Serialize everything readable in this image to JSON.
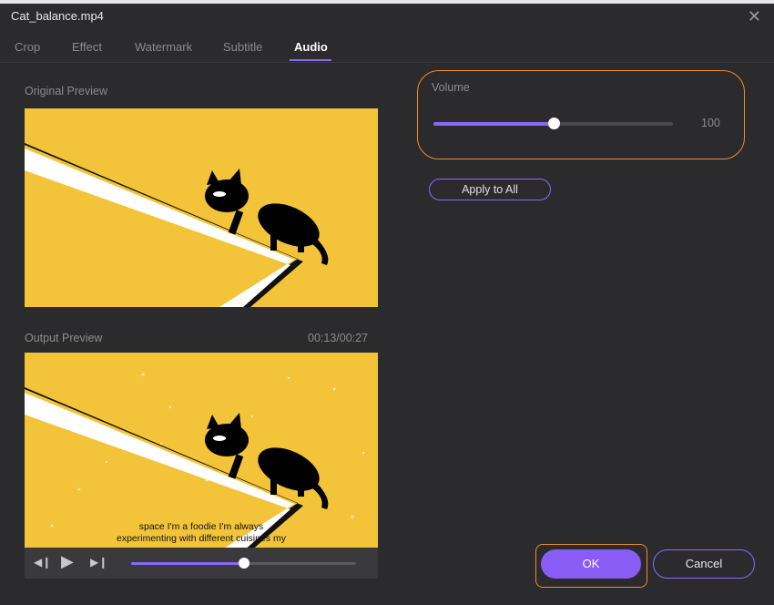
{
  "window": {
    "title": "Cat_balance.mp4"
  },
  "tabs": [
    {
      "label": "Crop"
    },
    {
      "label": "Effect"
    },
    {
      "label": "Watermark"
    },
    {
      "label": "Subtitle"
    },
    {
      "label": "Audio"
    }
  ],
  "active_tab": "Audio",
  "preview": {
    "original_label": "Original Preview",
    "output_label": "Output Preview",
    "time": "00:13/00:27",
    "subtitle_line1": "space I'm a foodie I'm always",
    "subtitle_line2": "experimenting with different cuisines my",
    "playback_progress": 0.5
  },
  "audio": {
    "volume_label": "Volume",
    "volume_value": "100",
    "volume_fraction": 0.5,
    "apply_all_label": "Apply to All"
  },
  "buttons": {
    "ok": "OK",
    "cancel": "Cancel"
  },
  "colors": {
    "accent": "#8a68ff",
    "highlight": "#f08a2c",
    "preview_bg": "#f3c43a"
  }
}
